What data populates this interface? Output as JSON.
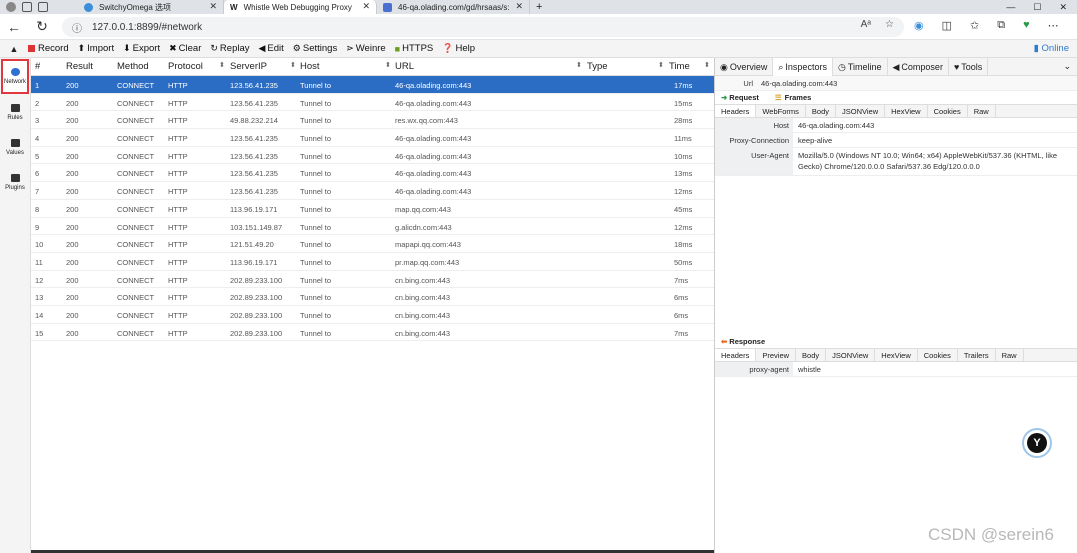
{
  "browser": {
    "tabs": [
      {
        "title": "SwitchyOmega 选项",
        "color": "#3b8fd8",
        "active": false
      },
      {
        "title": "Whistle Web Debugging Proxy",
        "color": "#222222",
        "active": true
      },
      {
        "title": "46-qa.olading.com/gd/hrsaas/s:",
        "color": "#4a6fd0",
        "active": false
      }
    ],
    "address": "127.0.0.1:8899/#network"
  },
  "toolbar": {
    "items": [
      {
        "label": "Record",
        "icon": "record-icon"
      },
      {
        "label": "Import",
        "icon": "import-icon"
      },
      {
        "label": "Export",
        "icon": "export-icon"
      },
      {
        "label": "Clear",
        "icon": "clear-icon"
      },
      {
        "label": "Replay",
        "icon": "replay-icon"
      },
      {
        "label": "Edit",
        "icon": "edit-icon"
      },
      {
        "label": "Settings",
        "icon": "settings-icon"
      },
      {
        "label": "Weinre",
        "icon": "weinre-icon"
      },
      {
        "label": "HTTPS",
        "icon": "lock-icon"
      },
      {
        "label": "Help",
        "icon": "help-icon"
      }
    ],
    "online": "Online"
  },
  "sidebar": {
    "items": [
      {
        "label": "Network",
        "active": true
      },
      {
        "label": "Rules",
        "active": false
      },
      {
        "label": "Values",
        "active": false
      },
      {
        "label": "Plugins",
        "active": false
      }
    ]
  },
  "list": {
    "headers": {
      "num": "#",
      "result": "Result",
      "method": "Method",
      "protocol": "Protocol",
      "serverip": "ServerIP",
      "host": "Host",
      "url": "URL",
      "type": "Type",
      "time": "Time"
    },
    "rows": [
      {
        "num": "1",
        "result": "200",
        "method": "CONNECT",
        "protocol": "HTTP",
        "ip": "123.56.41.235",
        "host": "Tunnel to",
        "url": "46-qa.olading.com:443",
        "time": "17ms"
      },
      {
        "num": "2",
        "result": "200",
        "method": "CONNECT",
        "protocol": "HTTP",
        "ip": "123.56.41.235",
        "host": "Tunnel to",
        "url": "46-qa.olading.com:443",
        "time": "15ms"
      },
      {
        "num": "3",
        "result": "200",
        "method": "CONNECT",
        "protocol": "HTTP",
        "ip": "49.88.232.214",
        "host": "Tunnel to",
        "url": "res.wx.qq.com:443",
        "time": "28ms"
      },
      {
        "num": "4",
        "result": "200",
        "method": "CONNECT",
        "protocol": "HTTP",
        "ip": "123.56.41.235",
        "host": "Tunnel to",
        "url": "46-qa.olading.com:443",
        "time": "11ms"
      },
      {
        "num": "5",
        "result": "200",
        "method": "CONNECT",
        "protocol": "HTTP",
        "ip": "123.56.41.235",
        "host": "Tunnel to",
        "url": "46-qa.olading.com:443",
        "time": "10ms"
      },
      {
        "num": "6",
        "result": "200",
        "method": "CONNECT",
        "protocol": "HTTP",
        "ip": "123.56.41.235",
        "host": "Tunnel to",
        "url": "46-qa.olading.com:443",
        "time": "13ms"
      },
      {
        "num": "7",
        "result": "200",
        "method": "CONNECT",
        "protocol": "HTTP",
        "ip": "123.56.41.235",
        "host": "Tunnel to",
        "url": "46-qa.olading.com:443",
        "time": "12ms"
      },
      {
        "num": "8",
        "result": "200",
        "method": "CONNECT",
        "protocol": "HTTP",
        "ip": "113.96.19.171",
        "host": "Tunnel to",
        "url": "map.qq.com:443",
        "time": "45ms"
      },
      {
        "num": "9",
        "result": "200",
        "method": "CONNECT",
        "protocol": "HTTP",
        "ip": "103.151.149.87",
        "host": "Tunnel to",
        "url": "g.alicdn.com:443",
        "time": "12ms"
      },
      {
        "num": "10",
        "result": "200",
        "method": "CONNECT",
        "protocol": "HTTP",
        "ip": "121.51.49.20",
        "host": "Tunnel to",
        "url": "mapapi.qq.com:443",
        "time": "18ms"
      },
      {
        "num": "11",
        "result": "200",
        "method": "CONNECT",
        "protocol": "HTTP",
        "ip": "113.96.19.171",
        "host": "Tunnel to",
        "url": "pr.map.qq.com:443",
        "time": "50ms"
      },
      {
        "num": "12",
        "result": "200",
        "method": "CONNECT",
        "protocol": "HTTP",
        "ip": "202.89.233.100",
        "host": "Tunnel to",
        "url": "cn.bing.com:443",
        "time": "7ms"
      },
      {
        "num": "13",
        "result": "200",
        "method": "CONNECT",
        "protocol": "HTTP",
        "ip": "202.89.233.100",
        "host": "Tunnel to",
        "url": "cn.bing.com:443",
        "time": "6ms"
      },
      {
        "num": "14",
        "result": "200",
        "method": "CONNECT",
        "protocol": "HTTP",
        "ip": "202.89.233.100",
        "host": "Tunnel to",
        "url": "cn.bing.com:443",
        "time": "6ms"
      },
      {
        "num": "15",
        "result": "200",
        "method": "CONNECT",
        "protocol": "HTTP",
        "ip": "202.89.233.100",
        "host": "Tunnel to",
        "url": "cn.bing.com:443",
        "time": "7ms"
      }
    ]
  },
  "detail": {
    "tabs": [
      "Overview",
      "Inspectors",
      "Timeline",
      "Composer",
      "Tools"
    ],
    "active_tab": "Inspectors",
    "url_label": "Url",
    "url_value": "46-qa.olading.com:443",
    "request_label": "Request",
    "frames_label": "Frames",
    "request_subtabs": [
      "Headers",
      "WebForms",
      "Body",
      "JSONView",
      "HexView",
      "Cookies",
      "Raw"
    ],
    "request_headers": [
      {
        "k": "Host",
        "v": "46-qa.olading.com:443"
      },
      {
        "k": "Proxy-Connection",
        "v": "keep-alive"
      },
      {
        "k": "User-Agent",
        "v": "Mozilla/5.0 (Windows NT 10.0; Win64; x64) AppleWebKit/537.36 (KHTML, like Gecko) Chrome/120.0.0.0 Safari/537.36 Edg/120.0.0.0"
      }
    ],
    "response_label": "Response",
    "response_subtabs": [
      "Headers",
      "Preview",
      "Body",
      "JSONView",
      "HexView",
      "Cookies",
      "Trailers",
      "Raw"
    ],
    "response_headers": [
      {
        "k": "proxy-agent",
        "v": "whistle"
      }
    ]
  },
  "watermark": "CSDN @serein6",
  "colors": {
    "selected_row": "#2b6cc4",
    "online": "#2e7bcf",
    "network_highlight": "#e0383e"
  }
}
